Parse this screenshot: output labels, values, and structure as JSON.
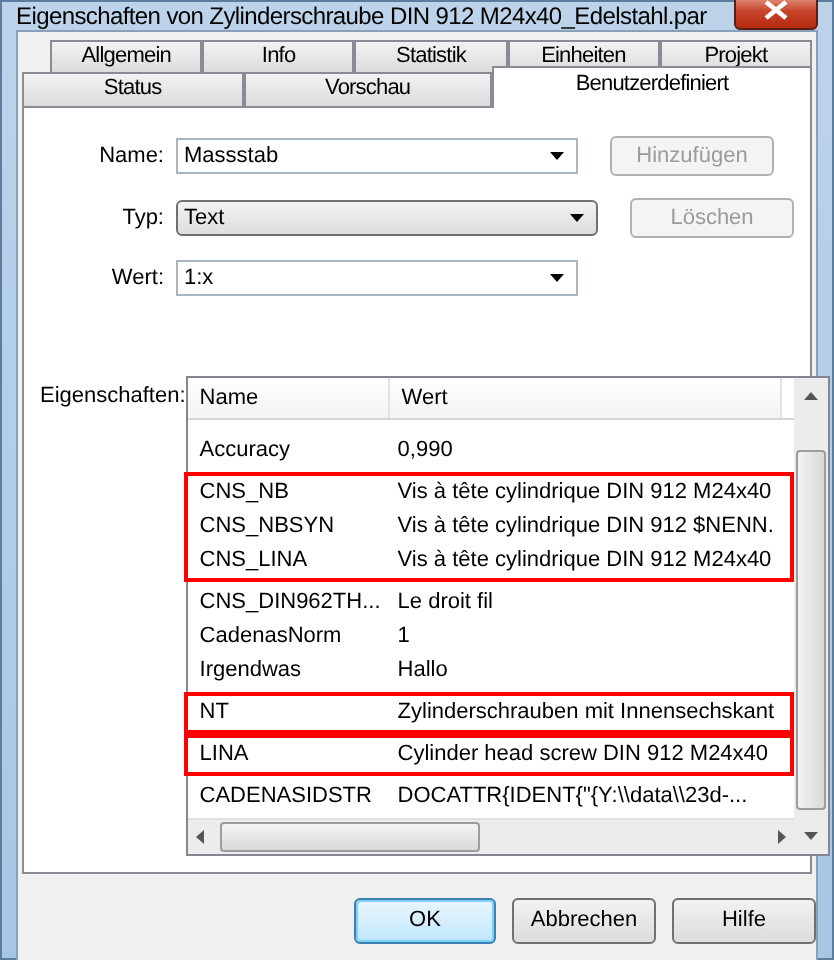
{
  "window": {
    "title": "Eigenschaften von Zylinderschraube DIN 912 M24x40_Edelstahl.par"
  },
  "tab_rows": [
    [
      {
        "label": "Allgemein",
        "selected": false
      },
      {
        "label": "Info",
        "selected": false
      },
      {
        "label": "Statistik",
        "selected": false
      },
      {
        "label": "Einheiten",
        "selected": false
      },
      {
        "label": "Projekt",
        "selected": false
      }
    ],
    [
      {
        "label": "Status",
        "selected": false
      },
      {
        "label": "Vorschau",
        "selected": false
      },
      {
        "label": "Benutzerdefiniert",
        "selected": true
      }
    ]
  ],
  "fields": [
    {
      "label": "Name:",
      "kind": "combo",
      "value": "Massstab",
      "button": {
        "label": "Hinzufügen",
        "disabled": true
      }
    },
    {
      "label": "Typ:",
      "kind": "list",
      "value": "Text",
      "button": {
        "label": "Löschen",
        "disabled": true
      }
    },
    {
      "label": "Wert:",
      "kind": "combo",
      "value": "1:x"
    }
  ],
  "properties": {
    "label": "Eigenschaften:",
    "columns": [
      "Name",
      "Wert"
    ],
    "row_groups": [
      {
        "highlighted": false,
        "rows": [
          [
            "Accuracy",
            "0,990"
          ]
        ]
      },
      {
        "highlighted": true,
        "rows": [
          [
            "CNS_NB",
            "Vis à tête cylindrique DIN 912 M24x40"
          ],
          [
            "CNS_NBSYN",
            "Vis à tête cylindrique DIN 912 $NENN."
          ],
          [
            "CNS_LINA",
            "Vis à tête cylindrique DIN 912 M24x40"
          ]
        ]
      },
      {
        "highlighted": false,
        "rows": [
          [
            "CNS_DIN962TH...",
            "Le droit fil"
          ],
          [
            "CadenasNorm",
            "1"
          ],
          [
            "Irgendwas",
            "Hallo"
          ]
        ]
      },
      {
        "highlighted": true,
        "rows": [
          [
            "NT",
            "Zylinderschrauben mit Innensechskant"
          ]
        ]
      },
      {
        "highlighted": true,
        "rows": [
          [
            "LINA",
            "Cylinder head screw DIN 912 M24x40"
          ]
        ]
      },
      {
        "highlighted": false,
        "rows": [
          [
            "CADENASIDSTR",
            "DOCATTR{IDENT{\"{Y:\\\\data\\\\23d-..."
          ]
        ]
      }
    ]
  },
  "buttons": [
    {
      "label": "OK",
      "default": true
    },
    {
      "label": "Abbrechen",
      "default": false
    },
    {
      "label": "Hilfe",
      "default": false
    }
  ]
}
